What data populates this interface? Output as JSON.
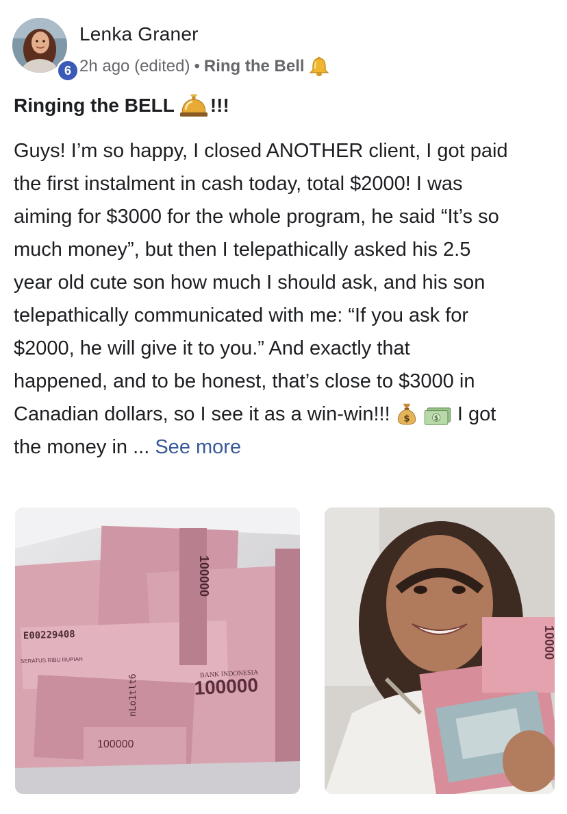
{
  "post": {
    "author": "Lenka Graner",
    "level_badge": "6",
    "time": "2h ago (edited)",
    "separator": "•",
    "category": "Ring the Bell",
    "category_icon": "bell-icon",
    "title_prefix": "Ringing the BELL",
    "title_icon": "service-bell-icon",
    "title_suffix": "!!!",
    "body_lines": [
      "Guys! I’m so happy, I closed ANOTHER client, I got paid",
      "the first instalment in cash today, total $2000! I was",
      "aiming for $3000 for the whole program, he said “It’s so",
      "much money”, but then I telepathically asked his 2.5",
      "year old cute son how much I should ask, and his son",
      "telepathically communicated with me: “If you ask for",
      "$2000, he will give it to you.” And exactly that",
      "happened, and to be honest, that’s close to $3000 in"
    ],
    "body_line9_text": "Canadian dollars, so I see it as a win-win!!!",
    "body_line9_after": "I got",
    "body_line9_icons": [
      "money-bag-icon",
      "dollar-banknote-icon"
    ],
    "body_line10": "the money in ...",
    "see_more": "See more"
  },
  "photos": {
    "left": {
      "icon": "cash-banknotes-photo",
      "banknote_labels": [
        "100000",
        "E00229408",
        "BANK INDONESIA",
        "SERATUS RIBU RUPIAH",
        "100000",
        "nLo1tlt6"
      ]
    },
    "right": {
      "icon": "woman-holding-cash-photo",
      "banknote_labels": [
        "10000"
      ]
    }
  },
  "colors": {
    "text": "#1c1e21",
    "meta": "#65676b",
    "link": "#385898",
    "badge": "#3b5ab7",
    "banknote_pink": "#d9a0ad"
  }
}
